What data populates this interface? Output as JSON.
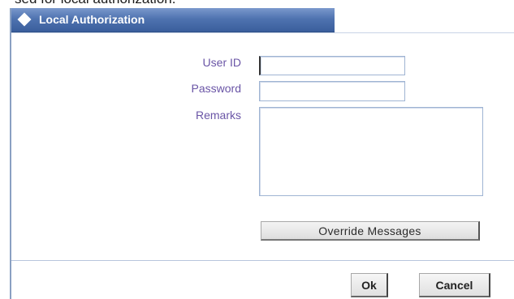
{
  "background_text": "sed for local authorization.",
  "dialog": {
    "title": "Local Authorization",
    "icon": "diamond-icon"
  },
  "form": {
    "user_id": {
      "label": "User ID",
      "value": ""
    },
    "password": {
      "label": "Password",
      "value": ""
    },
    "remarks": {
      "label": "Remarks",
      "value": ""
    }
  },
  "buttons": {
    "override": "Override Messages",
    "ok": "Ok",
    "cancel": "Cancel"
  },
  "colors": {
    "title_bar": "#4f73b0",
    "label_text": "#6a55a6",
    "input_border": "#9fb4d3"
  }
}
